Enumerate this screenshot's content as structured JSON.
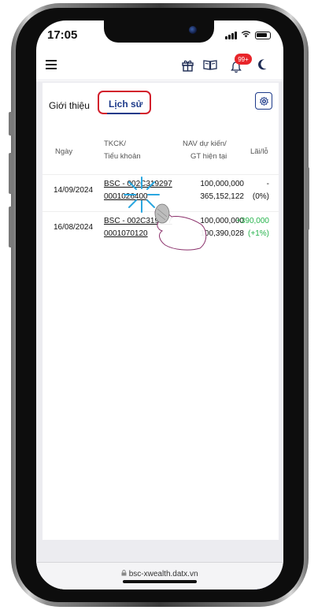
{
  "status_bar": {
    "time": "17:05"
  },
  "header": {
    "notification_count": "99+",
    "icons": [
      "menu-icon",
      "gift-icon",
      "book-icon",
      "bell-icon",
      "moon-icon"
    ]
  },
  "tabs": {
    "intro": "Giới thiệu",
    "history": "Lịch sử",
    "active": "history"
  },
  "table": {
    "headers": {
      "date": "Ngày",
      "account_line1": "TKCK/",
      "account_line2": "Tiểu khoản",
      "nav_line1": "NAV dự kiến/",
      "nav_line2": "GT hiện tại",
      "pnl": "Lãi/lỗ"
    },
    "rows": [
      {
        "date": "14/09/2024",
        "account_line1": "BSC - 002C319297",
        "account_line2": "0001026400",
        "nav": "100,000,000",
        "current": "365,152,122",
        "pnl_value": "-",
        "pnl_pct": "(0%)"
      },
      {
        "date": "16/08/2024",
        "account_line1": "BSC - 002C319297",
        "account_line2": "0001070120",
        "nav": "100,000,000",
        "current": "100,390,028",
        "pnl_value": "+390,000",
        "pnl_pct": "(+1%)"
      }
    ]
  },
  "browser": {
    "url": "bsc-xwealth.datx.vn"
  },
  "colors": {
    "primary": "#1d3a8a",
    "highlight": "#d21e2b",
    "positive": "#25b34b"
  }
}
